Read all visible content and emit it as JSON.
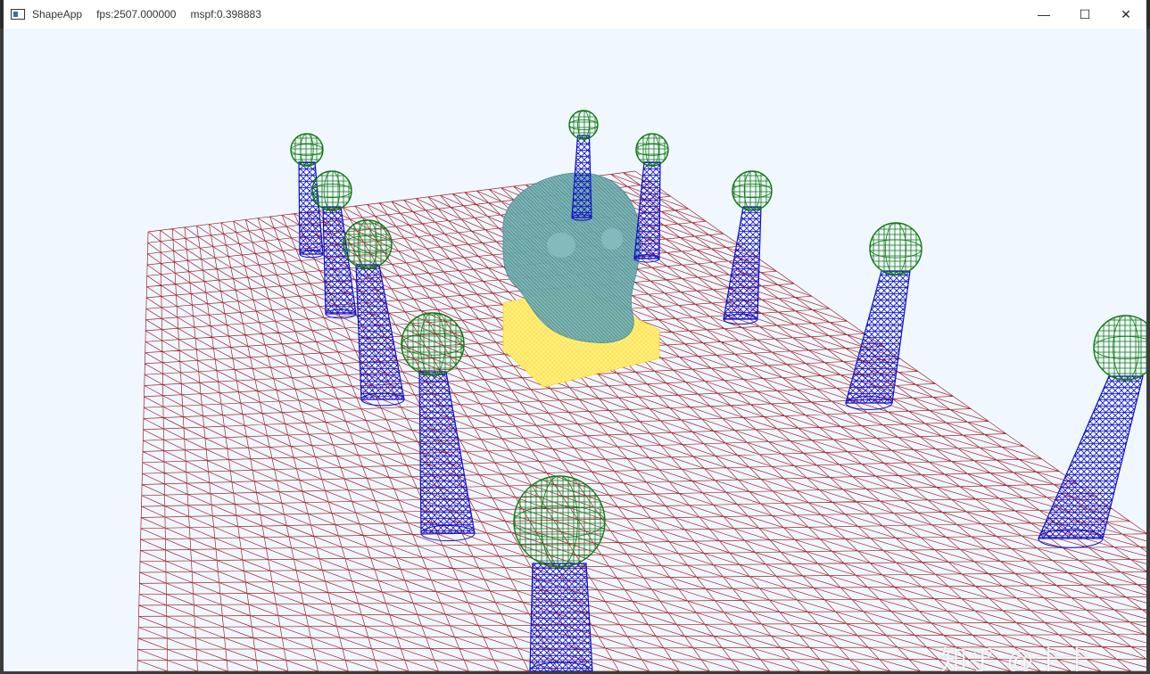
{
  "window": {
    "app_name": "ShapeApp",
    "fps_text": "fps:2507.000000",
    "mspf_text": "mspf:0.398883",
    "minimize_glyph": "—",
    "maximize_glyph": "☐",
    "close_glyph": "✕"
  },
  "scene": {
    "background_color": "#f0f7ff",
    "grid_color": "#a0242a",
    "cylinder_color": "#1010c8",
    "sphere_color": "#0f7a0f",
    "skull_color": "#5f9ea0",
    "box_color": "#ffee66",
    "objects": [
      "wireframe-grid",
      "skull",
      "box",
      "cylinders",
      "spheres"
    ]
  },
  "watermark": {
    "text": "知乎 @卡卡"
  }
}
